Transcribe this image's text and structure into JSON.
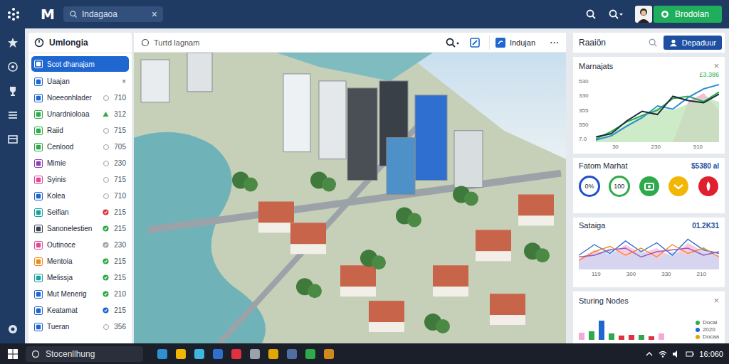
{
  "topbar": {
    "logo": "M",
    "search": {
      "value": "Indagaoa",
      "clear": "×"
    },
    "user_button": "Brodolan"
  },
  "left_panel": {
    "title": "Umlongia",
    "items": [
      {
        "label": "Scot dhanajam",
        "selected": true,
        "color": "#ffffff",
        "status": "none",
        "status_color": "#ffffff"
      },
      {
        "label": "Uaajan",
        "selected": false,
        "color": "#1e66d0",
        "value": "×",
        "status": "none",
        "status_color": "#555555"
      },
      {
        "label": "Noeeonhlader",
        "selected": false,
        "color": "#1e66d0",
        "value": "710",
        "status": "ring",
        "status_color": "#9aa3ad"
      },
      {
        "label": "Unardnioloaa",
        "selected": false,
        "color": "#2eaa4a",
        "value": "312",
        "status": "up",
        "status_color": "#2eaa4a"
      },
      {
        "label": "Raiid",
        "selected": false,
        "color": "#2eaa4a",
        "value": "715",
        "status": "ring",
        "status_color": "#9aa3ad"
      },
      {
        "label": "Cenlood",
        "selected": false,
        "color": "#2eaa4a",
        "value": "705",
        "status": "ring",
        "status_color": "#9aa3ad"
      },
      {
        "label": "Mimie",
        "selected": false,
        "color": "#8e3fb8",
        "value": "230",
        "status": "ring",
        "status_color": "#9aa3ad"
      },
      {
        "label": "Syinis",
        "selected": false,
        "color": "#e04a9a",
        "value": "715",
        "status": "ring",
        "status_color": "#9aa3ad"
      },
      {
        "label": "Kolea",
        "selected": false,
        "color": "#1e66d0",
        "value": "710",
        "status": "ring",
        "status_color": "#9aa3ad"
      },
      {
        "label": "Seifian",
        "selected": false,
        "color": "#17a2a0",
        "value": "215",
        "status": "dot",
        "status_color": "#e0313f"
      },
      {
        "label": "Sanonelestien",
        "selected": false,
        "color": "#3a4350",
        "value": "215",
        "status": "dot",
        "status_color": "#2eaa4a"
      },
      {
        "label": "Outinoce",
        "selected": false,
        "color": "#e04a9a",
        "value": "230",
        "status": "dot",
        "status_color": "#a0a6ad"
      },
      {
        "label": "Mentoia",
        "selected": false,
        "color": "#f08a1c",
        "value": "215",
        "status": "dot",
        "status_color": "#2eaa4a"
      },
      {
        "label": "Melissja",
        "selected": false,
        "color": "#17a2a0",
        "value": "215",
        "status": "dot",
        "status_color": "#2eaa4a"
      },
      {
        "label": "Mut Menerig",
        "selected": false,
        "color": "#1e66d0",
        "value": "210",
        "status": "dot",
        "status_color": "#2eaa4a"
      },
      {
        "label": "Keatamat",
        "selected": false,
        "color": "#1e66d0",
        "value": "215",
        "status": "dot",
        "status_color": "#1e66d0"
      },
      {
        "label": "Tueran",
        "selected": false,
        "color": "#1e66d0",
        "value": "356",
        "status": "ring",
        "status_color": "#9aa3ad"
      }
    ]
  },
  "center_toolbar": {
    "field": "Turtd lagnam",
    "chip": "Indujan",
    "more": "⋯"
  },
  "right_panel": {
    "title": "Raaiön",
    "button": "Depaduur",
    "line_card": {
      "title": "Marnajats",
      "close": "×",
      "value": "£3.386",
      "y_ticks": [
        "530",
        "330",
        "355",
        "550",
        "7.0"
      ],
      "x_ticks": [
        "30",
        "230",
        "510"
      ],
      "series": [
        {
          "kind": "area",
          "color": "#f7a8d8",
          "values": [
            0,
            0,
            0,
            0,
            0,
            0,
            380,
            460,
            300
          ]
        },
        {
          "kind": "area",
          "color": "#bfe6b8",
          "values": [
            40,
            90,
            170,
            260,
            320,
            300,
            360,
            420,
            380
          ]
        },
        {
          "kind": "line",
          "color": "#2eaa4a",
          "values": [
            30,
            100,
            190,
            250,
            300,
            410,
            430,
            380,
            470
          ]
        },
        {
          "kind": "line",
          "color": "#2f8fd0",
          "values": [
            20,
            60,
            150,
            230,
            340,
            310,
            420,
            500,
            540
          ]
        },
        {
          "kind": "line",
          "color": "#1b2a3a",
          "values": [
            50,
            80,
            200,
            290,
            260,
            430,
            390,
            370,
            450
          ]
        }
      ]
    },
    "badge_card": {
      "title": "Fatom Marhat",
      "value": "$5380 al",
      "badges": [
        {
          "kind": "text",
          "label": "0%",
          "color": "#1e4fd0"
        },
        {
          "kind": "text",
          "label": "100",
          "color": "#2eaa4a"
        },
        {
          "kind": "icon",
          "color": "#2eaa4a"
        },
        {
          "kind": "icon",
          "color": "#f2b705"
        },
        {
          "kind": "icon",
          "color": "#e0202f"
        }
      ]
    },
    "wave_card": {
      "title": "Sataiga",
      "value": "01.2K31",
      "x_ticks": [
        "119",
        "300",
        "330",
        "210"
      ],
      "series": [
        {
          "kind": "area",
          "color": "#f7b3d9",
          "values": [
            30,
            55,
            40,
            70,
            45,
            60,
            35,
            75,
            50,
            40
          ]
        },
        {
          "kind": "area",
          "color": "#c9d8f5",
          "values": [
            20,
            45,
            60,
            35,
            55,
            30,
            50,
            40,
            65,
            30
          ]
        },
        {
          "kind": "line",
          "color": "#2f6fd0",
          "values": [
            40,
            70,
            45,
            80,
            50,
            75,
            40,
            85,
            55,
            45
          ]
        },
        {
          "kind": "line",
          "color": "#f08a1c",
          "values": [
            25,
            50,
            65,
            40,
            60,
            35,
            70,
            45,
            60,
            35
          ]
        },
        {
          "kind": "line",
          "color": "#9b59b6",
          "values": [
            35,
            40,
            55,
            60,
            35,
            50,
            55,
            60,
            40,
            50
          ]
        }
      ]
    },
    "bar_card": {
      "title": "Sturing Nodes",
      "close": "×",
      "bars": [
        {
          "value": 35,
          "color": "#f7a8d8"
        },
        {
          "value": 40,
          "color": "#2eaa4a"
        },
        {
          "value": 90,
          "color": "#1e66d0"
        },
        {
          "value": 30,
          "color": "#2eaa4a"
        },
        {
          "value": 20,
          "color": "#e0313f"
        },
        {
          "value": 22,
          "color": "#e0313f"
        },
        {
          "value": 25,
          "color": "#2eaa4a"
        },
        {
          "value": 18,
          "color": "#e0313f"
        },
        {
          "value": 30,
          "color": "#f7a8d8"
        }
      ],
      "legend": [
        {
          "label": "Docai",
          "color": "#2eaa4a"
        },
        {
          "label": "2020",
          "color": "#1e66d0"
        },
        {
          "label": "Docaa",
          "color": "#e0a800"
        }
      ]
    }
  },
  "taskbar": {
    "search": "Stocenllhung",
    "time": "16:060"
  }
}
